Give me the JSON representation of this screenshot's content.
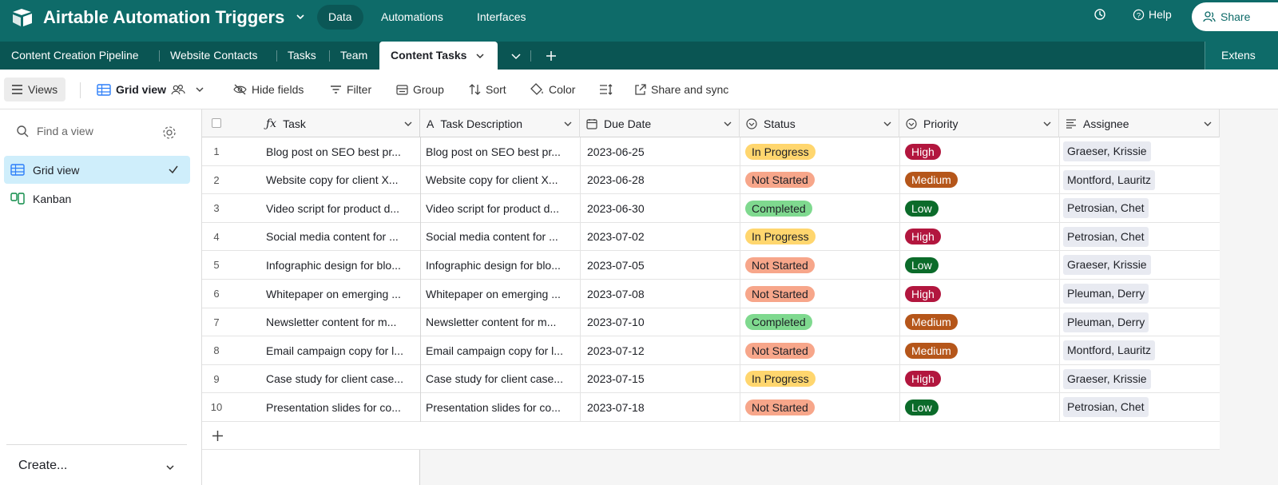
{
  "topbar": {
    "base_title": "Airtable Automation Triggers",
    "nav": [
      "Data",
      "Automations",
      "Interfaces"
    ],
    "help_label": "Help",
    "share_label": "Share",
    "background": "#0e6b69"
  },
  "tabs": {
    "items": [
      "Content Creation Pipeline",
      "Website Contacts",
      "Tasks",
      "Team"
    ],
    "active": "Content Tasks",
    "extensions_label": "Extens"
  },
  "viewbar": {
    "views_label": "Views",
    "grid_view_label": "Grid view",
    "hide_fields_label": "Hide fields",
    "filter_label": "Filter",
    "group_label": "Group",
    "sort_label": "Sort",
    "color_label": "Color",
    "share_sync_label": "Share and sync"
  },
  "sidebar": {
    "find_placeholder": "Find a view",
    "views": [
      {
        "label": "Grid view",
        "icon": "grid-icon"
      },
      {
        "label": "Kanban",
        "icon": "kanban-icon"
      }
    ],
    "create_label": "Create..."
  },
  "table": {
    "columns": [
      "Task",
      "Task Description",
      "Due Date",
      "Status",
      "Priority",
      "Assignee"
    ],
    "rows": [
      {
        "num": "1",
        "task": "Blog post on SEO best pr...",
        "desc": "Blog post on SEO best pr...",
        "due": "2023-06-25",
        "status": "In Progress",
        "priority": "High",
        "assignee": "Graeser, Krissie"
      },
      {
        "num": "2",
        "task": "Website copy for client X...",
        "desc": "Website copy for client X...",
        "due": "2023-06-28",
        "status": "Not Started",
        "priority": "Medium",
        "assignee": "Montford, Lauritz"
      },
      {
        "num": "3",
        "task": "Video script for product d...",
        "desc": "Video script for product d...",
        "due": "2023-06-30",
        "status": "Completed",
        "priority": "Low",
        "assignee": "Petrosian, Chet"
      },
      {
        "num": "4",
        "task": "Social media content for ...",
        "desc": "Social media content for ...",
        "due": "2023-07-02",
        "status": "In Progress",
        "priority": "High",
        "assignee": "Petrosian, Chet"
      },
      {
        "num": "5",
        "task": "Infographic design for blo...",
        "desc": "Infographic design for blo...",
        "due": "2023-07-05",
        "status": "Not Started",
        "priority": "Low",
        "assignee": "Graeser, Krissie"
      },
      {
        "num": "6",
        "task": "Whitepaper on emerging ...",
        "desc": "Whitepaper on emerging ...",
        "due": "2023-07-08",
        "status": "Not Started",
        "priority": "High",
        "assignee": "Pleuman, Derry"
      },
      {
        "num": "7",
        "task": "Newsletter content for m...",
        "desc": "Newsletter content for m...",
        "due": "2023-07-10",
        "status": "Completed",
        "priority": "Medium",
        "assignee": "Pleuman, Derry"
      },
      {
        "num": "8",
        "task": "Email campaign copy for l...",
        "desc": "Email campaign copy for l...",
        "due": "2023-07-12",
        "status": "Not Started",
        "priority": "Medium",
        "assignee": "Montford, Lauritz"
      },
      {
        "num": "9",
        "task": "Case study for client case...",
        "desc": "Case study for client case...",
        "due": "2023-07-15",
        "status": "In Progress",
        "priority": "High",
        "assignee": "Graeser, Krissie"
      },
      {
        "num": "10",
        "task": "Presentation slides for co...",
        "desc": "Presentation slides for co...",
        "due": "2023-07-18",
        "status": "Not Started",
        "priority": "Low",
        "assignee": "Petrosian, Chet"
      }
    ]
  },
  "colors": {
    "status": {
      "In Progress": "#ffd66e",
      "Not Started": "#f7a68a",
      "Completed": "#7fd98f"
    },
    "priority": {
      "High": "#b2163e",
      "Medium": "#b5561a",
      "Low": "#0b6b2a"
    }
  }
}
